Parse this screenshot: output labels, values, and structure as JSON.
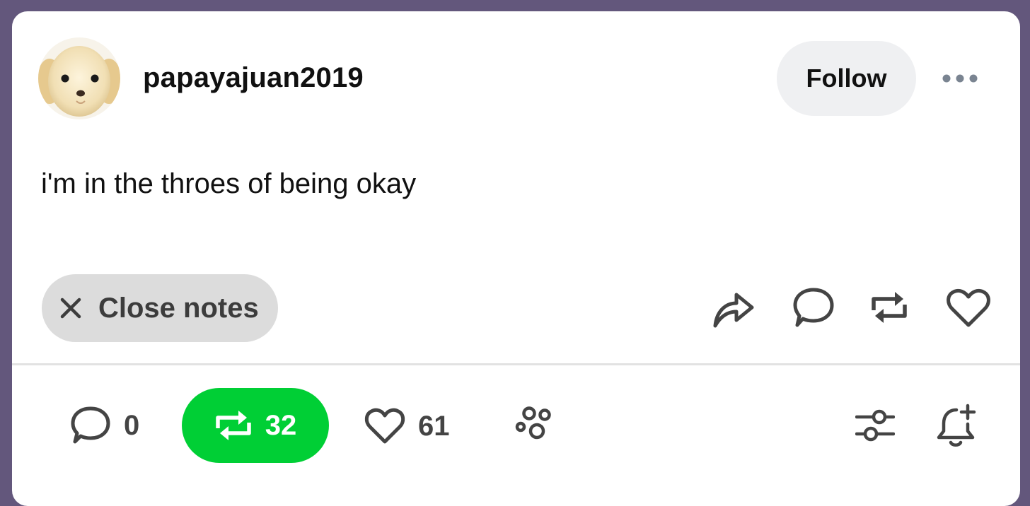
{
  "post": {
    "username": "papayajuan2019",
    "follow_label": "Follow",
    "text": "i'm in the throes of being okay",
    "avatar_icon": "puppy-avatar"
  },
  "notes_bar": {
    "close_label": "Close notes",
    "actions": [
      "share-icon",
      "reply-icon",
      "reblog-icon",
      "like-icon"
    ]
  },
  "stats": {
    "replies": "0",
    "reblogs": "32",
    "likes": "61"
  },
  "colors": {
    "background": "#63577c",
    "reblog_active": "#00cf35",
    "icon": "#444444"
  }
}
